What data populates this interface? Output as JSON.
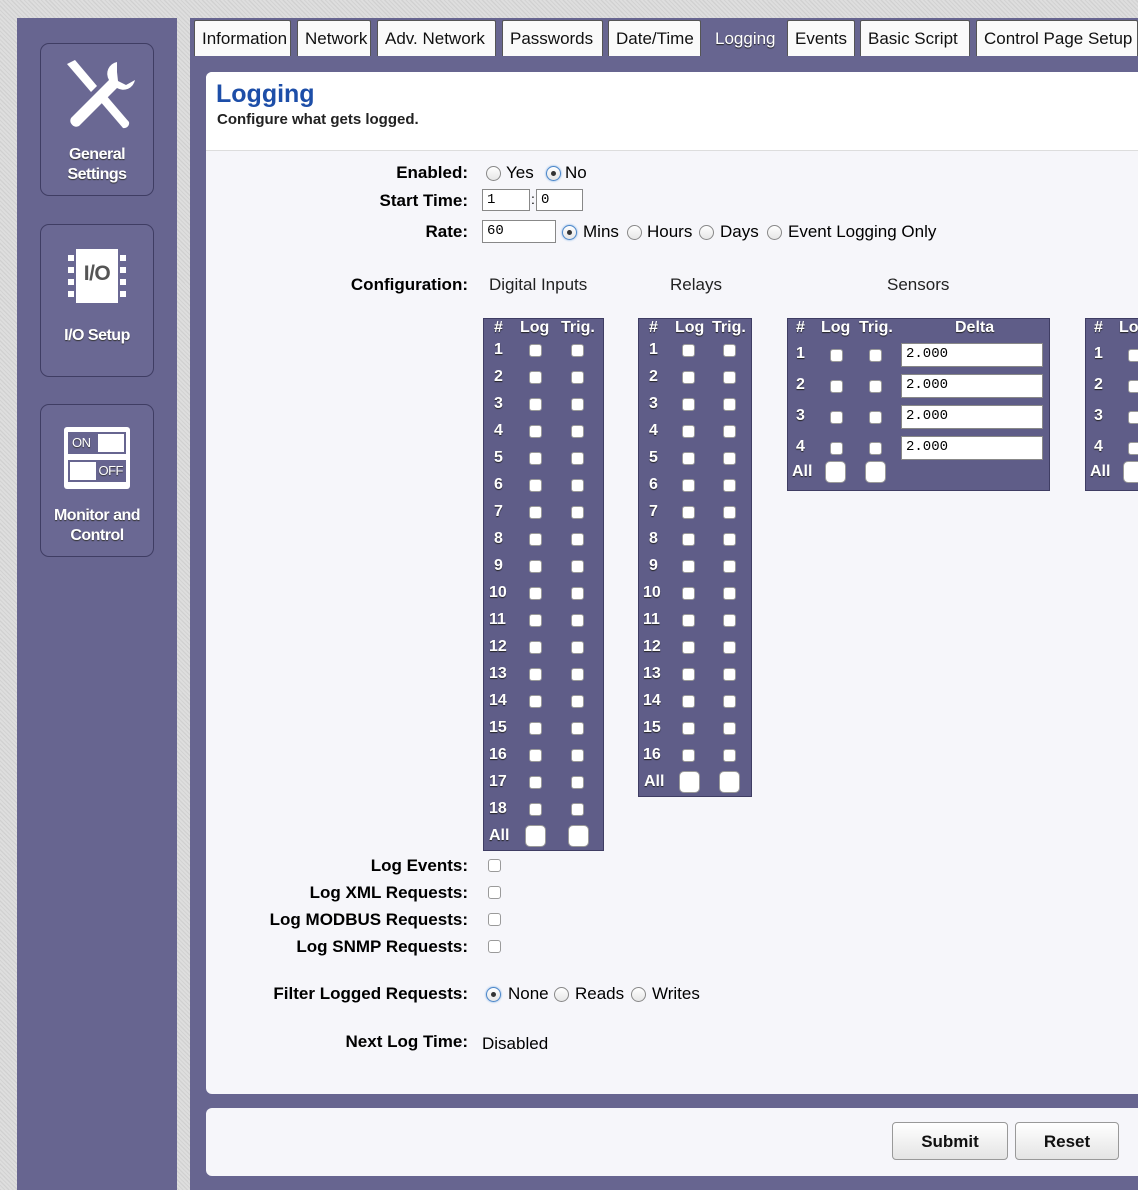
{
  "sidebar": {
    "items": [
      {
        "label_line1": "General",
        "label_line2": "Settings",
        "icon": "wrench-screwdriver-icon"
      },
      {
        "label": "I/O Setup",
        "icon": "io-chip-icon",
        "icon_text": "I/O"
      },
      {
        "label_line1": "Monitor and",
        "label_line2": "Control",
        "icon": "on-off-switch-icon",
        "on_text": "ON",
        "off_text": "OFF"
      }
    ]
  },
  "tabs": [
    "Information",
    "Network",
    "Adv. Network",
    "Passwords",
    "Date/Time",
    "Logging",
    "Events",
    "Basic Script",
    "Control Page Setup"
  ],
  "active_tab": "Logging",
  "page": {
    "title": "Logging",
    "subtitle": "Configure what gets logged."
  },
  "form": {
    "enabled_label": "Enabled:",
    "enabled_yes": "Yes",
    "enabled_no": "No",
    "enabled_value": "No",
    "start_time_label": "Start Time:",
    "start_hour": "1",
    "start_sep": ":",
    "start_min": "0",
    "rate_label": "Rate:",
    "rate_value": "60",
    "rate_options": [
      "Mins",
      "Hours",
      "Days",
      "Event Logging Only"
    ],
    "rate_selected": "Mins",
    "configuration_label": "Configuration:",
    "log_events_label": "Log Events:",
    "log_xml_label": "Log XML Requests:",
    "log_modbus_label": "Log MODBUS Requests:",
    "log_snmp_label": "Log SNMP Requests:",
    "filter_label": "Filter Logged Requests:",
    "filter_options": [
      "None",
      "Reads",
      "Writes"
    ],
    "filter_selected": "None",
    "next_log_label": "Next Log Time:",
    "next_log_value": "Disabled"
  },
  "digital_inputs": {
    "heading": "Digital Inputs",
    "col_num": "#",
    "col_log": "Log",
    "col_trig": "Trig.",
    "rows": [
      "1",
      "2",
      "3",
      "4",
      "5",
      "6",
      "7",
      "8",
      "9",
      "10",
      "11",
      "12",
      "13",
      "14",
      "15",
      "16",
      "17",
      "18"
    ],
    "all_label": "All"
  },
  "relays": {
    "heading": "Relays",
    "col_num": "#",
    "col_log": "Log",
    "col_trig": "Trig.",
    "rows": [
      "1",
      "2",
      "3",
      "4",
      "5",
      "6",
      "7",
      "8",
      "9",
      "10",
      "11",
      "12",
      "13",
      "14",
      "15",
      "16"
    ],
    "all_label": "All"
  },
  "sensors": {
    "heading": "Sensors",
    "col_num": "#",
    "col_log": "Log",
    "col_trig": "Trig.",
    "col_delta": "Delta",
    "rows": [
      {
        "num": "1",
        "delta": "2.000"
      },
      {
        "num": "2",
        "delta": "2.000"
      },
      {
        "num": "3",
        "delta": "2.000"
      },
      {
        "num": "4",
        "delta": "2.000"
      }
    ],
    "all_label": "All"
  },
  "fourth_table": {
    "col_num": "#",
    "col_log": "Lo",
    "rows": [
      "1",
      "2",
      "3",
      "4"
    ],
    "all_label": "All"
  },
  "buttons": {
    "submit": "Submit",
    "reset": "Reset"
  },
  "colors": {
    "frame": "#676590",
    "title": "#1d4ea8",
    "table": "#5f5d88"
  }
}
